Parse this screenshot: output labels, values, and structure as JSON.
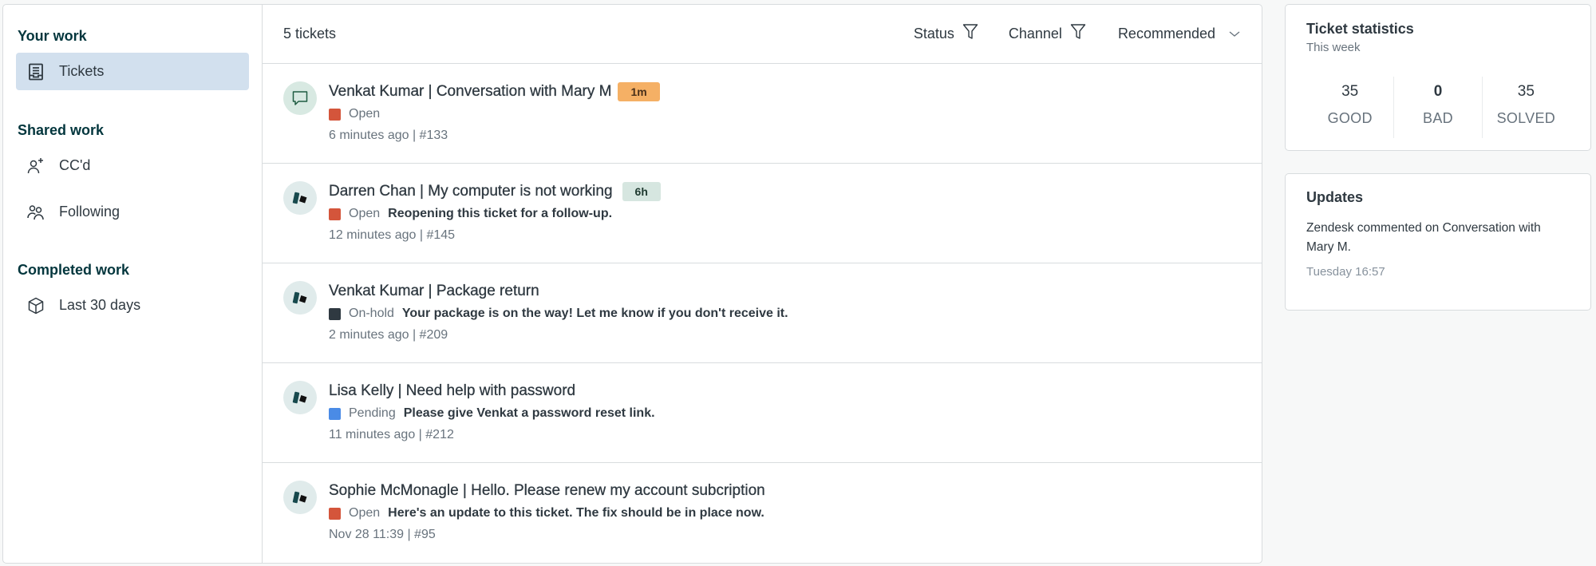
{
  "sidebar": {
    "sections": [
      {
        "title": "Your work",
        "items": [
          {
            "label": "Tickets",
            "icon": "inbox-icon",
            "active": true
          }
        ]
      },
      {
        "title": "Shared work",
        "items": [
          {
            "label": "CC'd",
            "icon": "user-plus-icon",
            "active": false
          },
          {
            "label": "Following",
            "icon": "users-icon",
            "active": false
          }
        ]
      },
      {
        "title": "Completed work",
        "items": [
          {
            "label": "Last 30 days",
            "icon": "box-icon",
            "active": false
          }
        ]
      }
    ]
  },
  "ticket_list": {
    "count_label": "5 tickets",
    "filters": {
      "status_label": "Status",
      "channel_label": "Channel",
      "sort_label": "Recommended"
    },
    "tickets": [
      {
        "title": "Venkat Kumar | Conversation with Mary M",
        "avatar_icon": "chat-bubble-icon",
        "badge": "1m",
        "badge_bg": "#f5b065",
        "badge_fg": "#49301a",
        "status": "Open",
        "status_color": "#d4553b",
        "message": "",
        "meta": "6 minutes ago | #133"
      },
      {
        "title": "Darren Chan | My computer is not working",
        "avatar_icon": "zendesk-logo-icon",
        "badge": "6h",
        "badge_bg": "#d6e6e0",
        "badge_fg": "#1f3a30",
        "status": "Open",
        "status_color": "#d4553b",
        "message": "Reopening this ticket for a follow-up.",
        "meta": "12 minutes ago | #145"
      },
      {
        "title": "Venkat Kumar | Package return",
        "avatar_icon": "zendesk-logo-icon",
        "badge": "",
        "status": "On-hold",
        "status_color": "#2f3941",
        "message": "Your package is on the way! Let me know if you don't receive it.",
        "meta": "2 minutes ago | #209"
      },
      {
        "title": "Lisa Kelly | Need help with password",
        "avatar_icon": "zendesk-logo-icon",
        "badge": "",
        "status": "Pending",
        "status_color": "#4a8be6",
        "message": "Please give Venkat a password reset link.",
        "meta": "11 minutes ago | #212"
      },
      {
        "title": "Sophie McMonagle | Hello. Please renew my account subcription",
        "avatar_icon": "zendesk-logo-icon",
        "badge": "",
        "status": "Open",
        "status_color": "#d4553b",
        "message": "Here's an update to this ticket. The fix should be in place now.",
        "meta": "Nov 28 11:39 | #95"
      }
    ]
  },
  "stats": {
    "title": "Ticket statistics",
    "subtitle": "This week",
    "items": [
      {
        "value": "35",
        "label": "GOOD"
      },
      {
        "value": "0",
        "label": "BAD"
      },
      {
        "value": "35",
        "label": "SOLVED"
      }
    ]
  },
  "updates": {
    "title": "Updates",
    "text": "Zendesk commented on Conversation with Mary M.",
    "time": "Tuesday 16:57"
  }
}
